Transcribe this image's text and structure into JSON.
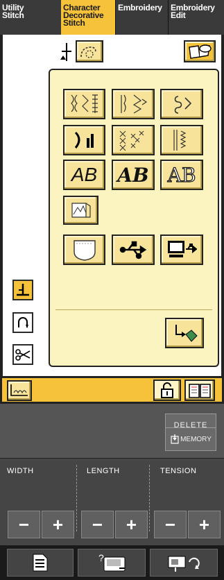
{
  "tabs": [
    {
      "line1": "Utility",
      "line2": "Stitch",
      "line3": ""
    },
    {
      "line1": "Character",
      "line2": "Decorative",
      "line3": "Stitch"
    },
    {
      "line1": "Embroidery",
      "line2": "",
      "line3": ""
    },
    {
      "line1": "Embroidery",
      "line2": "Edit",
      "line3": ""
    }
  ],
  "active_tab": 1,
  "grid": {
    "rows": [
      [
        "decorative-stitch-icon",
        "satin-stitch-icon",
        "cross-stitch-icon"
      ],
      [
        "character-stitch-icon",
        "cross-pattern-icon",
        "zigzag-stitch-icon"
      ],
      [
        "gothic-font-icon",
        "script-font-icon",
        "outline-font-icon"
      ],
      [
        "my-custom-stitch-icon"
      ],
      [
        "pocket-memory-icon",
        "usb-icon",
        "computer-icon"
      ]
    ],
    "text": {
      "gothic": "AB",
      "script": "AB",
      "outline": "AB"
    }
  },
  "buttons": {
    "delete": "DELETE",
    "memory": "MEMORY"
  },
  "controls": {
    "width": "WIDTH",
    "length": "LENGTH",
    "tension": "TENSION",
    "minus": "−",
    "plus": "+"
  },
  "colors": {
    "accent": "#f5c23a",
    "panel": "#fbf4c0",
    "dark": "#333333"
  }
}
